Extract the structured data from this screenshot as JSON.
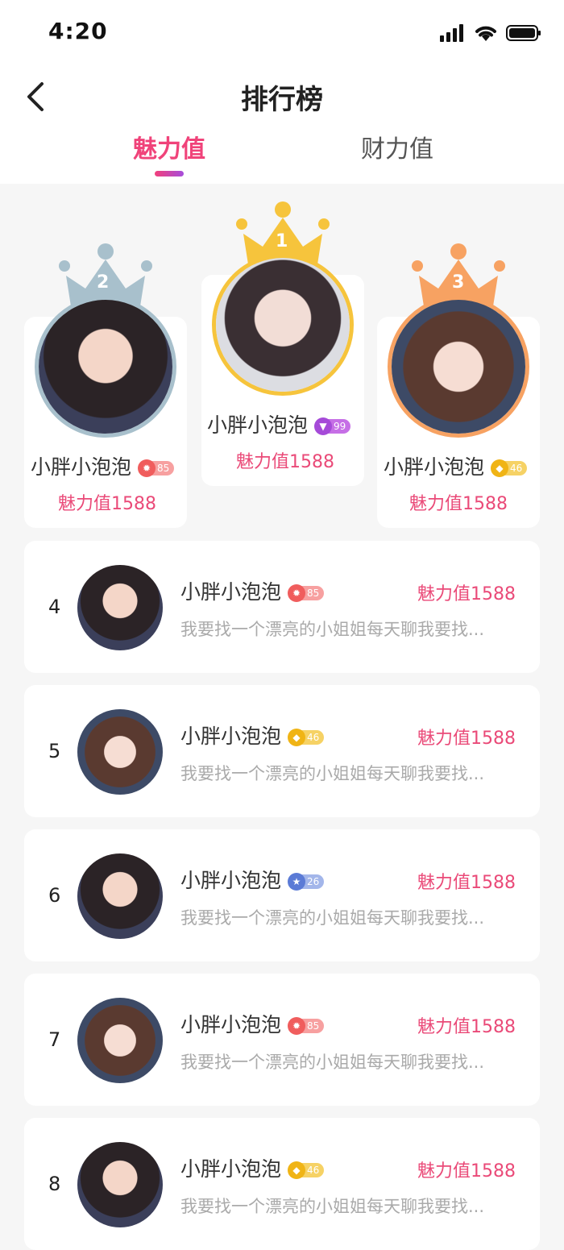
{
  "status_bar": {
    "time": "4:20"
  },
  "nav": {
    "title": "排行榜"
  },
  "tabs": [
    {
      "label": "魅力值",
      "active": true
    },
    {
      "label": "财力值",
      "active": false
    }
  ],
  "colors": {
    "accent": "#f0437a",
    "silver": "#a8c0cc",
    "gold": "#f6c43c",
    "bronze": "#f7a262"
  },
  "podium": [
    {
      "rank": "2",
      "name": "小胖小泡泡",
      "level": "85",
      "badge": "red-medal-icon",
      "charm": "魅力值1588"
    },
    {
      "rank": "1",
      "name": "小胖小泡泡",
      "level": "99",
      "badge": "purple-gem-icon",
      "charm": "魅力值1588"
    },
    {
      "rank": "3",
      "name": "小胖小泡泡",
      "level": "46",
      "badge": "gold-medal-icon",
      "charm": "魅力值1588"
    }
  ],
  "list": [
    {
      "rank": "4",
      "name": "小胖小泡泡",
      "level": "85",
      "badge": "red-medal-icon",
      "charm": "魅力值1588",
      "desc": "我要找一个漂亮的小姐姐每天聊我要找..."
    },
    {
      "rank": "5",
      "name": "小胖小泡泡",
      "level": "46",
      "badge": "gold-medal-icon",
      "charm": "魅力值1588",
      "desc": "我要找一个漂亮的小姐姐每天聊我要找..."
    },
    {
      "rank": "6",
      "name": "小胖小泡泡",
      "level": "26",
      "badge": "blue-medal-icon",
      "charm": "魅力值1588",
      "desc": "我要找一个漂亮的小姐姐每天聊我要找..."
    },
    {
      "rank": "7",
      "name": "小胖小泡泡",
      "level": "85",
      "badge": "red-medal-icon",
      "charm": "魅力值1588",
      "desc": "我要找一个漂亮的小姐姐每天聊我要找..."
    },
    {
      "rank": "8",
      "name": "小胖小泡泡",
      "level": "46",
      "badge": "gold-medal-icon",
      "charm": "魅力值1588",
      "desc": "我要找一个漂亮的小姐姐每天聊我要找..."
    }
  ]
}
